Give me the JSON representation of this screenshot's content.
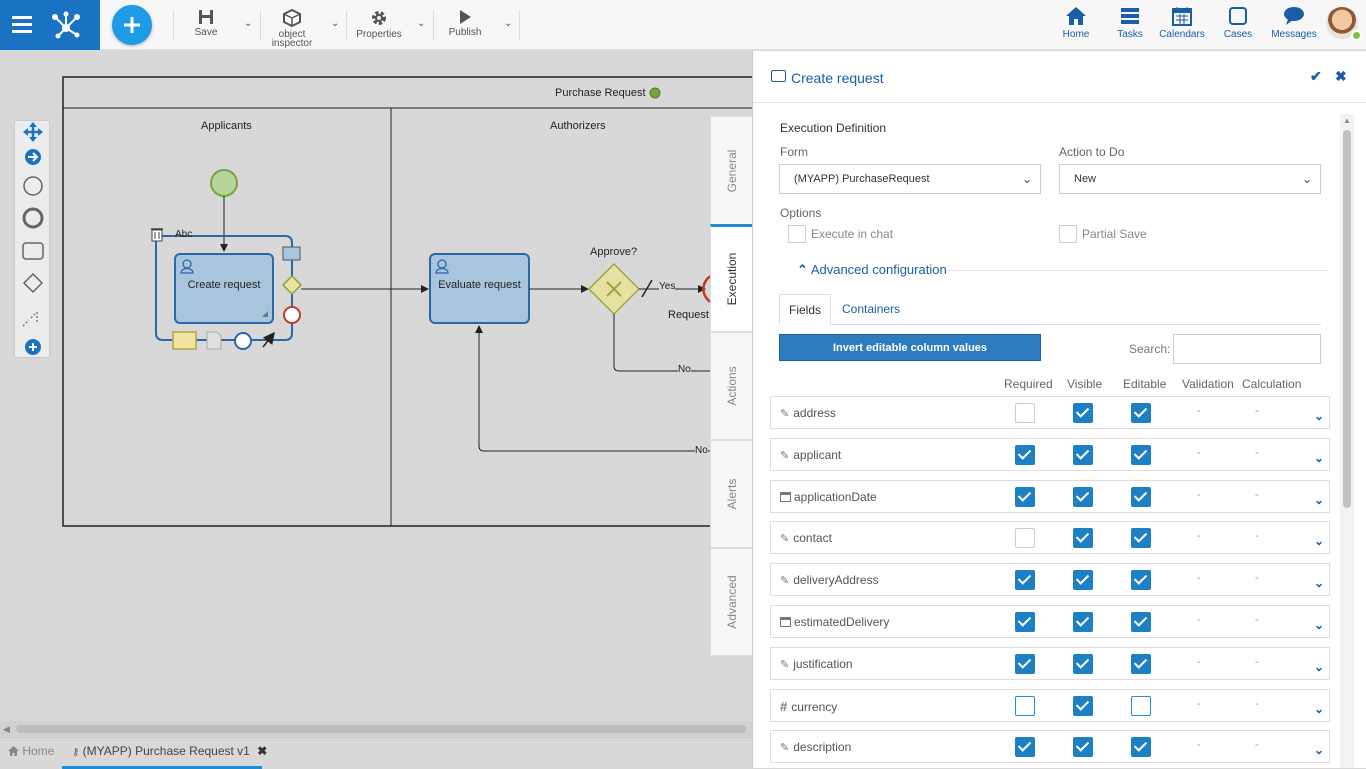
{
  "toolbar": {
    "save_label": "Save",
    "object_inspector_label": "object inspector",
    "properties_label": "Properties",
    "publish_label": "Publish"
  },
  "nav": {
    "home": "Home",
    "tasks": "Tasks",
    "calendars": "Calendars",
    "cases": "Cases",
    "messages": "Messages"
  },
  "diagram": {
    "pool_title": "Purchase Request",
    "lane1": "Applicants",
    "lane2": "Authorizers",
    "task1": "Create request",
    "task2": "Evaluate request",
    "gateway_label": "Approve?",
    "yes_label": "Yes",
    "no_label1": "No",
    "no_label2": "No",
    "request_label": "Request",
    "text_tool": "Abc"
  },
  "bottom_tabs": {
    "home": "Home",
    "process": "(MYAPP) Purchase Request v1"
  },
  "side_tabs": [
    "General",
    "Execution",
    "Actions",
    "Alerts",
    "Advanced"
  ],
  "panel": {
    "title": "Create request",
    "section": "Execution Definition",
    "form_label": "Form",
    "form_value": "(MYAPP) PurchaseRequest",
    "action_label": "Action to Do",
    "action_value": "New",
    "options_label": "Options",
    "execute_in_chat": "Execute in chat",
    "partial_save": "Partial Save",
    "advanced_config": "Advanced configuration",
    "tab_fields": "Fields",
    "tab_containers": "Containers",
    "invert_button": "Invert editable column values",
    "search_label": "Search:",
    "search_value": "",
    "columns": [
      "Required",
      "Visible",
      "Editable",
      "Validation",
      "Calculation"
    ]
  },
  "fields": [
    {
      "name": "address",
      "icon": "edit-icon",
      "required": false,
      "visible": true,
      "editable": true,
      "validation": "-",
      "calculation": "-"
    },
    {
      "name": "applicant",
      "icon": "edit-icon",
      "required": true,
      "visible": true,
      "editable": true,
      "validation": "-",
      "calculation": "-"
    },
    {
      "name": "applicationDate",
      "icon": "calendar-icon",
      "required": true,
      "visible": true,
      "editable": true,
      "validation": "-",
      "calculation": "-"
    },
    {
      "name": "contact",
      "icon": "edit-icon",
      "required": false,
      "visible": true,
      "editable": true,
      "validation": "-",
      "calculation": "-"
    },
    {
      "name": "deliveryAddress",
      "icon": "edit-icon",
      "required": true,
      "visible": true,
      "editable": true,
      "validation": "-",
      "calculation": "-"
    },
    {
      "name": "estimatedDelivery",
      "icon": "calendar-icon",
      "required": true,
      "visible": true,
      "editable": true,
      "validation": "-",
      "calculation": "-"
    },
    {
      "name": "justification",
      "icon": "edit-icon",
      "required": true,
      "visible": true,
      "editable": true,
      "validation": "-",
      "calculation": "-"
    },
    {
      "name": "currency",
      "icon": "hash-icon",
      "required": false,
      "visible": true,
      "editable": false,
      "validation": "-",
      "calculation": "-"
    },
    {
      "name": "description",
      "icon": "edit-icon",
      "required": true,
      "visible": true,
      "editable": true,
      "validation": "-",
      "calculation": "-"
    }
  ],
  "colors": {
    "brand": "#1a73c2",
    "accent": "#1d8dd6",
    "check": "#1d7fc4",
    "task_fill": "#a9c5de"
  }
}
